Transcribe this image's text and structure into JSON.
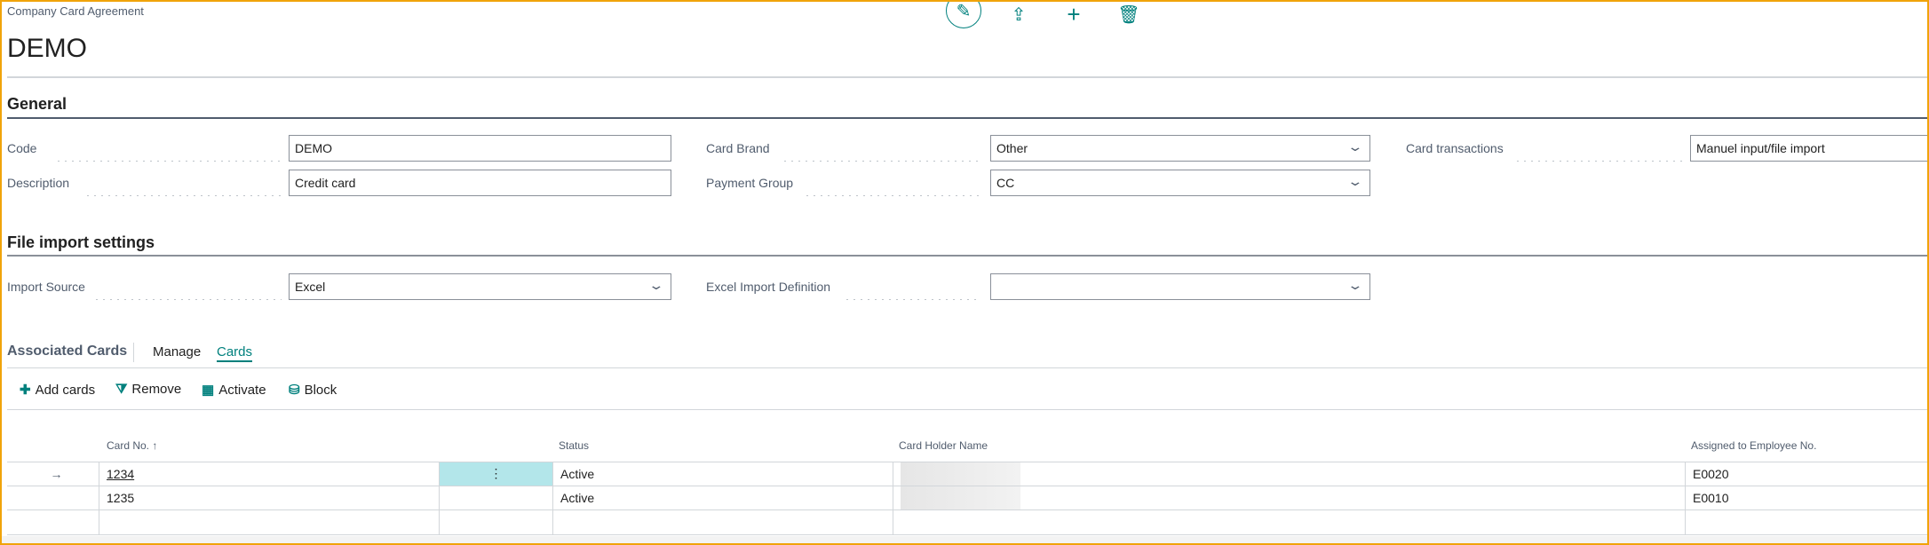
{
  "header": {
    "breadcrumb": "Company Card Agreement",
    "title": "DEMO"
  },
  "actions": {
    "edit": "pencil-icon",
    "share": "share-icon",
    "new": "plus-icon",
    "delete": "trash-icon"
  },
  "general": {
    "title": "General",
    "code_label": "Code",
    "code_value": "DEMO",
    "description_label": "Description",
    "description_value": "Credit card",
    "card_brand_label": "Card Brand",
    "card_brand_value": "Other",
    "payment_group_label": "Payment Group",
    "payment_group_value": "CC",
    "card_transactions_label": "Card transactions",
    "card_transactions_value": "Manuel input/file import"
  },
  "file_import": {
    "title": "File import settings",
    "import_source_label": "Import Source",
    "import_source_value": "Excel",
    "excel_def_label": "Excel Import Definition",
    "excel_def_value": ""
  },
  "cards": {
    "title": "Associated Cards",
    "tabs": [
      "Manage",
      "Cards"
    ],
    "toolbar": {
      "add": "Add cards",
      "remove": "Remove",
      "activate": "Activate",
      "block": "Block"
    },
    "columns": {
      "card_no": "Card No. ↑",
      "status": "Status",
      "holder": "Card Holder Name",
      "employee": "Assigned to Employee No."
    },
    "rows": [
      {
        "card_no": "1234",
        "status": "Active",
        "holder": "",
        "employee": "E0020"
      },
      {
        "card_no": "1235",
        "status": "Active",
        "holder": "",
        "employee": "E0010"
      }
    ],
    "row_arrow": "→",
    "row_menu": "⋮"
  },
  "colors": {
    "accent": "#00807d",
    "frame": "#f0a30a",
    "selected_cell": "#b3e6ea"
  }
}
